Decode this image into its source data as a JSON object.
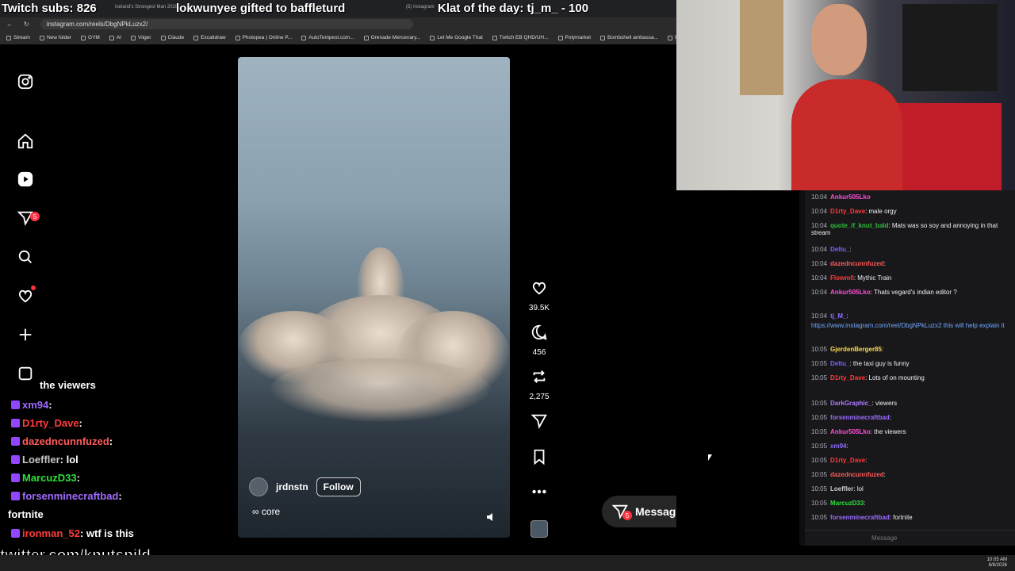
{
  "overlay_top": {
    "subs": "Twitch subs: 826",
    "gift": "lokwunyee gifted to baffleturd",
    "klat": "Klat of the day: tj_m_ - 100",
    "tab1": "Iceland's Strongest Man 2028",
    "tab2": "(5) Instagram"
  },
  "browser": {
    "url": "instagram.com/reels/DbgNPkLuzx2/",
    "bookmarks": [
      "Stream",
      "New folder",
      "GYM",
      "AI",
      "Viiger",
      "Claude",
      "Excalidraw",
      "Photopea | Online P...",
      "AutoTempest.com...",
      "Grenade Mercenary...",
      "Let Me Google That",
      "Twitch EB QHD/UH...",
      "Polymarket",
      "Bombshell ambassa...",
      "ProChat - The"
    ]
  },
  "instagram": {
    "sidebar": {
      "messages_badge": "5"
    },
    "reel": {
      "username": "jrdnstn",
      "follow_label": "Follow",
      "audio": "∞ core"
    },
    "actions": {
      "likes": "39.5K",
      "comments": "456",
      "reposts": "2,275"
    },
    "messages_bar": {
      "label": "Messages",
      "badge": "5"
    }
  },
  "twitch_chat": [
    {
      "time": "10:04",
      "user": "Ankur505Lko",
      "color": "#ff4fd8",
      "msg": ""
    },
    {
      "time": "10:04",
      "user": "D1rty_Dave",
      "color": "#ff3b3b",
      "msg": ": male orgy"
    },
    {
      "time": "10:04",
      "user": "quote_if_knut_bald",
      "color": "#2fbf3a",
      "msg": ": Mats was so soy and annoying in that stream"
    },
    {
      "time": "10:04",
      "user": "Deltu_",
      "color": "#7b61ff",
      "msg": ":"
    },
    {
      "time": "10:04",
      "user": "dazedncunnfuzed",
      "color": "#ff5a5a",
      "msg": ":"
    },
    {
      "time": "10:04",
      "user": "Flowm0",
      "color": "#ff3b3b",
      "msg": ": Mythic Train"
    },
    {
      "time": "10:04",
      "user": "Ankur505Lko",
      "color": "#ff4fd8",
      "msg": ": Thats vegard's indian editor ?"
    },
    {
      "time": "10:04",
      "user": "tj_M_",
      "color": "#8f6bff",
      "msg": ":"
    },
    {
      "time": "",
      "user": "",
      "color": "#6fa8ff",
      "msg": "https://www.instagram.com/reel/DbgNPkLuzx2 this will help explain it"
    },
    {
      "time": "10:05",
      "user": "GjerdenBerger85",
      "color": "#ffd84a",
      "msg": ":"
    },
    {
      "time": "10:05",
      "user": "Deltu_",
      "color": "#7b61ff",
      "msg": ": the taxi guy is funny"
    },
    {
      "time": "10:05",
      "user": "D1rty_Dave",
      "color": "#ff3b3b",
      "msg": ": Lots of  on  mounting"
    },
    {
      "time": "10:05",
      "user": "DarkGraphic_",
      "color": "#b07bff",
      "msg": ": viewers"
    },
    {
      "time": "10:05",
      "user": "forsenminecraftbad",
      "color": "#9b6bff",
      "msg": ":"
    },
    {
      "time": "10:05",
      "user": "Ankur505Lko",
      "color": "#ff4fd8",
      "msg": ": the viewers"
    },
    {
      "time": "10:05",
      "user": "xm94",
      "color": "#8f6bff",
      "msg": ":"
    },
    {
      "time": "10:05",
      "user": "D1rty_Dave",
      "color": "#ff3b3b",
      "msg": ":"
    },
    {
      "time": "10:05",
      "user": "dazedncunnfuzed",
      "color": "#ff5a5a",
      "msg": ":"
    },
    {
      "time": "10:05",
      "user": "Loeffler",
      "color": "#c8c8c8",
      "msg": ": lol"
    },
    {
      "time": "10:05",
      "user": "MarcuzD33",
      "color": "#2fe03a",
      "msg": ":"
    },
    {
      "time": "10:05",
      "user": "forsenminecraftbad",
      "color": "#9b6bff",
      "msg": ": fortnite"
    }
  ],
  "chat_input_placeholder": "Message",
  "overlay_chat": [
    {
      "user": "",
      "color": "#fff",
      "msg": "the viewers"
    },
    {
      "user": "xm94",
      "color": "#a06bff",
      "msg": ":"
    },
    {
      "user": "D1rty_Dave",
      "color": "#ff3b3b",
      "msg": ":"
    },
    {
      "user": "dazedncunnfuzed",
      "color": "#ff5a5a",
      "msg": ":"
    },
    {
      "user": "Loeffler",
      "color": "#c8c8c8",
      "msg": ": lol"
    },
    {
      "user": "MarcuzD33",
      "color": "#2fe03a",
      "msg": ":"
    },
    {
      "user": "forsenminecraftbad",
      "color": "#a06bff",
      "msg": ":"
    },
    {
      "user": "",
      "color": "#fff",
      "msg": "fortnite"
    },
    {
      "user": "ironman_52",
      "color": "#ff3b3b",
      "msg": ": wtf is this"
    }
  ],
  "twitter_handle": "twitter.com/knutspild",
  "tray": {
    "time": "10:05 AM",
    "date": "8/8/2026"
  }
}
